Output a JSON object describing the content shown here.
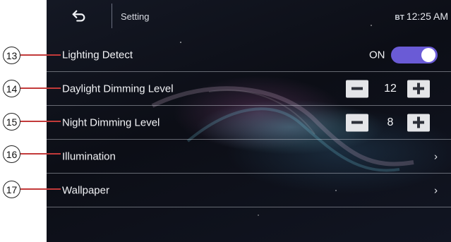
{
  "topbar": {
    "title": "Setting",
    "bt_label": "BT",
    "time": "12:25 AM"
  },
  "rows": [
    {
      "label": "Lighting Detect",
      "control": "toggle",
      "toggle_text": "ON",
      "toggle_state": true
    },
    {
      "label": "Daylight Dimming Level",
      "control": "stepper",
      "value": "12"
    },
    {
      "label": "Night Dimming Level",
      "control": "stepper",
      "value": "8"
    },
    {
      "label": "Illumination",
      "control": "chevron",
      "chevron": "›"
    },
    {
      "label": "Wallpaper",
      "control": "chevron",
      "chevron": "›"
    }
  ],
  "callouts": [
    "13",
    "14",
    "15",
    "16",
    "17"
  ],
  "colors": {
    "accent_toggle": "#6a5bd6",
    "callout_line": "#c23a3a",
    "background": "#0c0e16"
  },
  "icons": {
    "back": "back-arrow-icon",
    "chevron": "chevron-right-icon",
    "minus": "minus-icon",
    "plus": "plus-icon"
  }
}
